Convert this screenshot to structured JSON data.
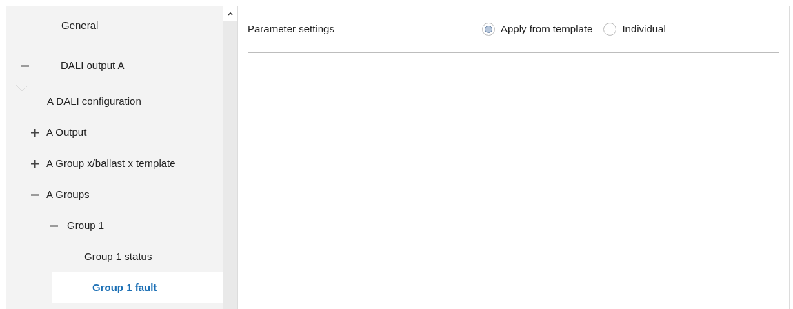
{
  "sidebar": {
    "items": [
      {
        "label": "General",
        "selected": false
      },
      {
        "label": "DALI output A",
        "selected": false,
        "expanded": true,
        "children": [
          {
            "label": "A DALI configuration",
            "selected": false
          },
          {
            "label": "A Output",
            "selected": false,
            "expanded": false
          },
          {
            "label": "A Group x/ballast x template",
            "selected": false,
            "expanded": false
          },
          {
            "label": "A Groups",
            "selected": false,
            "expanded": true,
            "children": [
              {
                "label": "Group 1",
                "selected": false,
                "expanded": true,
                "children": [
                  {
                    "label": "Group 1 status",
                    "selected": false
                  },
                  {
                    "label": "Group 1 fault",
                    "selected": true
                  }
                ]
              }
            ]
          }
        ]
      }
    ]
  },
  "parameter": {
    "label": "Parameter settings",
    "options": [
      {
        "label": "Apply from template",
        "selected": true
      },
      {
        "label": "Individual",
        "selected": false
      }
    ]
  }
}
